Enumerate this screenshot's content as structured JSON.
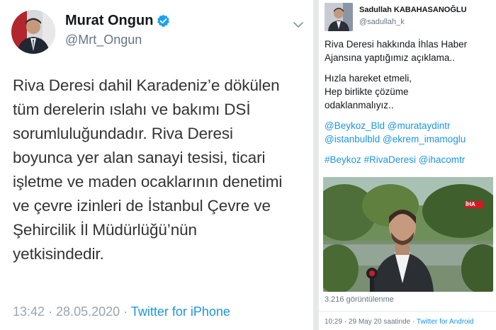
{
  "left_tweet": {
    "name": "Murat Ongun",
    "handle": "@Mrt_Ongun",
    "text_lines": [
      "Riva Deresi dahil Karadeniz’e dökülen",
      "tüm derelerin ıslahı ve bakımı DSİ",
      "sorumluluğundadır. Riva Deresi",
      "boyunca yer alan sanayi tesisi, ticari",
      "işletme ve maden ocaklarının denetimi",
      "ve çevre izinleri de İstanbul Çevre ve",
      "Şehircilik İl Müdürlüğü’nün",
      "yetkisindedir."
    ],
    "time_date": "13:42 · 28.05.2020 · ",
    "source": "Twitter for iPhone",
    "verified_icon": "verified-badge-icon",
    "menu_icon": "chevron-down-icon",
    "accent_color": "#1b95e0"
  },
  "right_tweet": {
    "name": "Sadullah KABAHASANOĞLU",
    "handle": "@sadullah_k",
    "paragraph1": [
      "Riva Deresi hakkında İhlas Haber",
      "Ajansına yaptığımız açıklama.."
    ],
    "paragraph2": [
      "Hızla hareket etmeli,",
      "Hep birlikte çözüme",
      "odaklanmalıyız.."
    ],
    "mentions_line1": "@Beykoz_Bld @murataydintr",
    "mentions_line2": "@istanbulbld @ekrem_imamoglu",
    "hashtags_line": "#Beykoz #RivaDeresi @ihacomtr",
    "video_logo": "İHA",
    "views": "3.216 görüntülenme",
    "time_date": "10:29 · 29 May 20 saatinde · ",
    "source": "Twitter for Android"
  }
}
